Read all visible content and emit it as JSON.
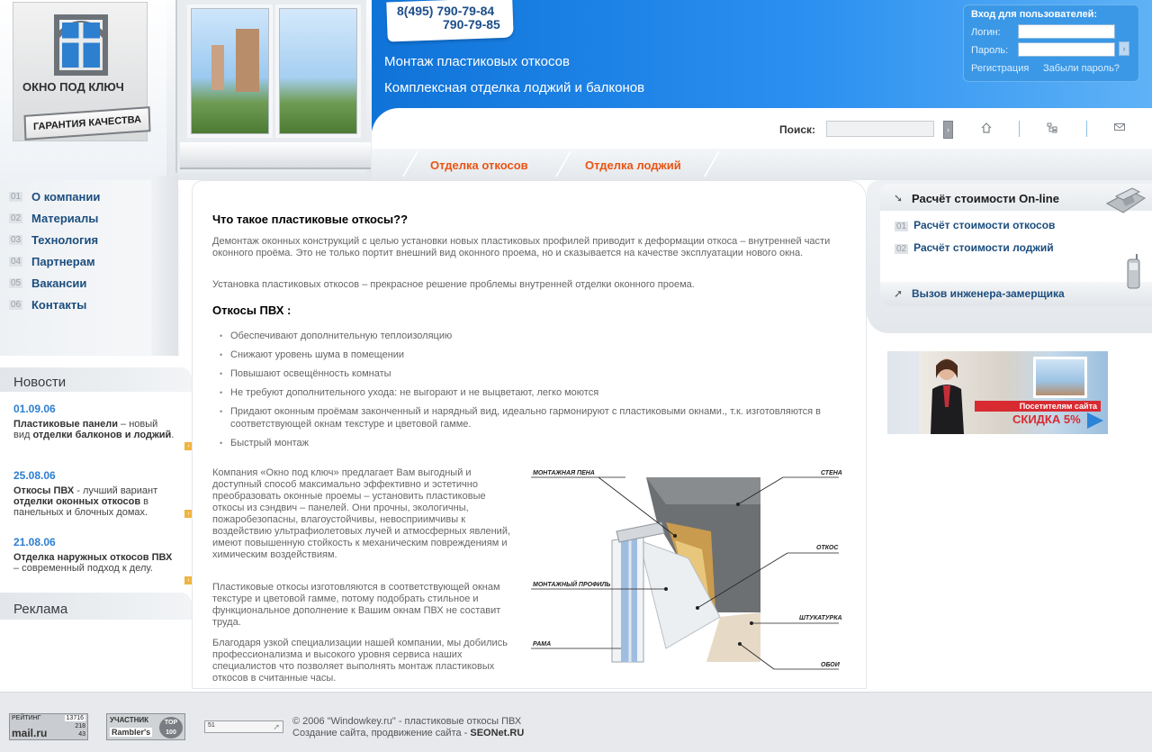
{
  "header": {
    "logo_title": "ОКНО ПОД КЛЮЧ",
    "logo_badge": "ГАРАНТИЯ КАЧЕСТВА",
    "phone1": "8(495) 790-79-84",
    "phone2": "790-79-85",
    "slogan1": "Монтаж пластиковых откосов",
    "slogan2": "Комплексная отделка лоджий и балконов",
    "search_label": "Поиск:",
    "search_placeholder": "",
    "tabs": [
      {
        "label": "Отделка откосов"
      },
      {
        "label": "Отделка лоджий"
      }
    ]
  },
  "login": {
    "title": "Вход для пользователей:",
    "login_label": "Логин:",
    "password_label": "Пароль:",
    "login_value": "",
    "password_value": "",
    "register_link": "Регистрация",
    "forgot_link": "Забыли пароль?"
  },
  "sidebar": {
    "items": [
      {
        "num": "01",
        "label": "О компании"
      },
      {
        "num": "02",
        "label": "Материалы"
      },
      {
        "num": "03",
        "label": "Технология"
      },
      {
        "num": "04",
        "label": "Партнерам"
      },
      {
        "num": "05",
        "label": "Вакансии"
      },
      {
        "num": "06",
        "label": "Контакты"
      }
    ],
    "news_title": "Новости",
    "news": [
      {
        "date": "01.09.06",
        "bold": "Пластиковые панели",
        "rest1": " – новый вид ",
        "bold2": "отделки балконов и лоджий",
        "rest2": "."
      },
      {
        "date": "25.08.06",
        "bold": "Откосы ПВХ",
        "rest1": " - лучший вариант ",
        "bold2": "отделки оконных откосов",
        "rest2": " в панельных и блочных домах."
      },
      {
        "date": "21.08.06",
        "bold": "Отделка наружных откосов ПВХ",
        "rest1": " – современный подход к делу.",
        "bold2": "",
        "rest2": ""
      }
    ],
    "ads_title": "Реклама"
  },
  "main": {
    "heading": "Что такое пластиковые откосы??",
    "p1": "Демонтаж оконных конструкций с целью установки новых пластиковых профилей приводит к деформации откоса – внутренней части оконного проёма. Это не только портит внешний вид оконного проема, но и сказывается на качестве эксплуатации нового окна.",
    "p2": "Установка пластиковых откосов – прекрасное решение проблемы внутренней отделки оконного проема.",
    "subheading": "Откосы ПВХ :",
    "bullets": [
      "Обеспечивают дополнительную теплоизоляцию",
      "Снижают уровень шума в помещении",
      "Повышают освещённость комнаты",
      "Не требуют дополнительного ухода: не выгорают и не выцветают, легко моются",
      "Придают оконным проёмам законченный и нарядный вид, идеально гармонируют с пластиковыми окнами., т.к. изготовляются в соответствующей окнам текстуре и цветовой гамме.",
      "Быстрый монтаж"
    ],
    "body1": "Компания «Окно под ключ» предлагает Вам выгодный и доступный способ максимально эффективно и эстетично преобразовать оконные проемы – установить пластиковые откосы из сэндвич – панелей. Они прочны, экологичны, пожаробезопасны, влагоустойчивы, невосприимчивы к воздействию ультрафиолетовых лучей и атмосферных явлений, имеют повышенную стойкость к механическим повреждениям и химическим воздействиям.",
    "body2": "Пластиковые откосы изготовляются в соответствующей окнам текстуре и цветовой гамме, потому подобрать стильное и функциональное дополнение к Вашим окнам ПВХ не составит труда.",
    "body3": "Благодаря узкой специализации нашей компании, мы добились профессионализма и высокого уровня сервиса наших специалистов что позволяет выполнять монтаж пластиковых откосов в считанные часы.",
    "diagram_labels": {
      "foam": "МОНТАЖНАЯ ПЕНА",
      "wall": "СТЕНА",
      "slope": "ОТКОС",
      "profile": "МОНТАЖНЫЙ ПРОФИЛЬ",
      "plaster": "ШТУКАТУРКА",
      "frame": "РАМА",
      "wallpaper": "ОБОИ"
    }
  },
  "right": {
    "calc_title": "Расчёт стоимости On-line",
    "calc_items": [
      {
        "num": "01",
        "label": "Расчёт стоимости откосов"
      },
      {
        "num": "02",
        "label": "Расчёт стоимости лоджий"
      }
    ],
    "engineer": "Вызов инженера-замерщика",
    "promo_line1": "Посетителям сайта",
    "promo_line2": "СКИДКА 5%"
  },
  "footer": {
    "counter1_label": "РЕЙТИНГ",
    "counter1_site": "mail.ru",
    "counter1_values": [
      "13716",
      "218",
      "43"
    ],
    "counter2_label": "УЧАСТНИК",
    "counter2_brand": "Rambler's",
    "counter2_top": "TOP 100",
    "counter3_value": "51",
    "copyright": "© 2006 \"Windowkey.ru\" - пластиковые откосы ПВХ",
    "credits_text": "Создание сайта, продвижение сайта - ",
    "credits_brand": "SEONet.RU"
  },
  "colors": {
    "accent_blue": "#1b78dc",
    "tab_orange": "#ea5413",
    "nav_blue": "#1b4d7e",
    "date_blue": "#2d7fcf"
  }
}
